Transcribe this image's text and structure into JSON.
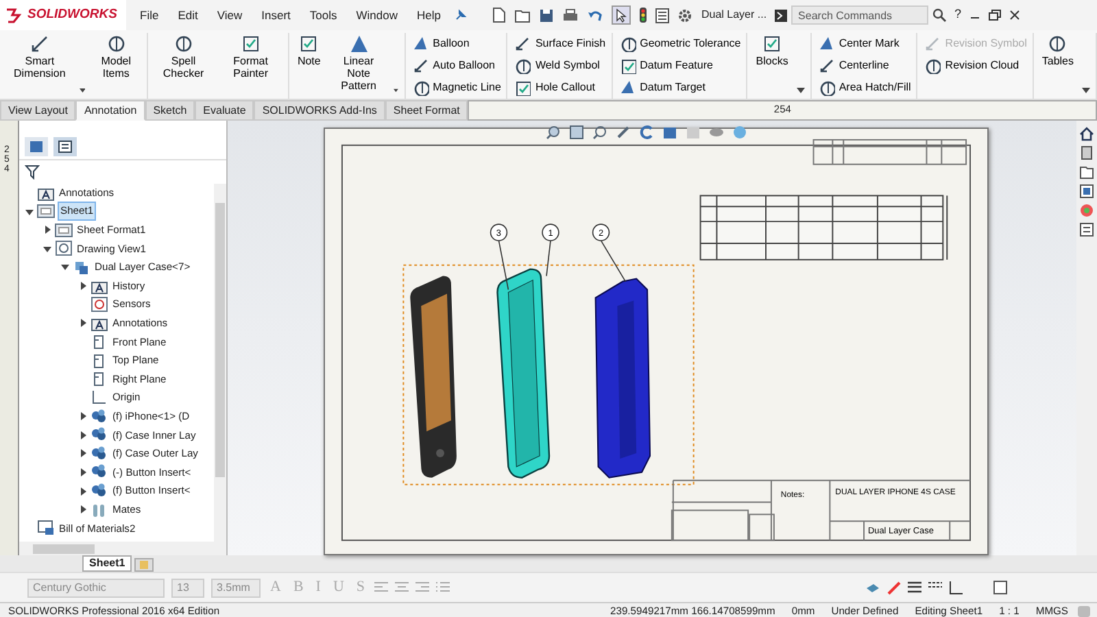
{
  "app": {
    "logo": "SOLIDWORKS",
    "menu": [
      "File",
      "Edit",
      "View",
      "Insert",
      "Tools",
      "Window",
      "Help"
    ],
    "document_title": "Dual Layer ...",
    "search": {
      "placeholder": "Search Commands"
    },
    "help": "?"
  },
  "ribbon": {
    "groups": [
      {
        "items": [
          {
            "label": "Smart Dimension",
            "kind": "large",
            "disabled": false,
            "dropdown": true
          },
          {
            "label": "Model Items",
            "kind": "large",
            "disabled": false,
            "dropdown": false
          }
        ]
      },
      {
        "items": [
          {
            "label": "Spell Checker",
            "kind": "large",
            "disabled": false,
            "dropdown": false
          },
          {
            "label": "Format Painter",
            "kind": "large",
            "disabled": false,
            "dropdown": false
          }
        ]
      },
      {
        "items": [
          {
            "label": "Note",
            "kind": "large",
            "disabled": false,
            "dropdown": false
          },
          {
            "label": "Linear Note Pattern",
            "kind": "large",
            "disabled": false,
            "dropdown": true
          }
        ]
      },
      {
        "items": [
          {
            "label": "Balloon",
            "kind": "small",
            "disabled": false
          },
          {
            "label": "Auto Balloon",
            "kind": "small",
            "disabled": false
          },
          {
            "label": "Magnetic Line",
            "kind": "small",
            "disabled": false
          }
        ]
      },
      {
        "items": [
          {
            "label": "Surface Finish",
            "kind": "small",
            "disabled": false
          },
          {
            "label": "Weld Symbol",
            "kind": "small",
            "disabled": false
          },
          {
            "label": "Hole Callout",
            "kind": "small",
            "disabled": false
          }
        ]
      },
      {
        "items": [
          {
            "label": "Geometric Tolerance",
            "kind": "small",
            "disabled": false
          },
          {
            "label": "Datum Feature",
            "kind": "small",
            "disabled": false
          },
          {
            "label": "Datum Target",
            "kind": "small",
            "disabled": false
          }
        ]
      },
      {
        "items": [
          {
            "label": "Blocks",
            "kind": "large",
            "disabled": false,
            "dropdown": true
          }
        ]
      },
      {
        "items": [
          {
            "label": "Center Mark",
            "kind": "small",
            "disabled": false
          },
          {
            "label": "Centerline",
            "kind": "small",
            "disabled": false
          },
          {
            "label": "Area Hatch/Fill",
            "kind": "small",
            "disabled": false
          }
        ]
      },
      {
        "items": [
          {
            "label": "Revision Symbol",
            "kind": "small",
            "disabled": true
          },
          {
            "label": "Revision Cloud",
            "kind": "small",
            "disabled": false
          }
        ]
      },
      {
        "items": [
          {
            "label": "Tables",
            "kind": "large",
            "disabled": false,
            "dropdown": true
          }
        ]
      }
    ]
  },
  "tabs": [
    {
      "label": "View Layout",
      "selected": false
    },
    {
      "label": "Annotation",
      "selected": true
    },
    {
      "label": "Sketch",
      "selected": false
    },
    {
      "label": "Evaluate",
      "selected": false
    },
    {
      "label": "SOLIDWORKS Add-Ins",
      "selected": false
    },
    {
      "label": "Sheet Format",
      "selected": false
    }
  ],
  "top_ruler": {
    "label": "254"
  },
  "side_ruler": {
    "label": "254"
  },
  "tree": [
    {
      "label": "Annotations",
      "kind": "folder",
      "expandable": false,
      "selected": false
    },
    {
      "label": "Sheet1",
      "kind": "sheet",
      "expandable": true,
      "expanded": true,
      "selected": true,
      "children": [
        {
          "label": "Sheet Format1",
          "kind": "sheet",
          "expandable": true,
          "expanded": false,
          "selected": false
        },
        {
          "label": "Drawing View1",
          "kind": "view",
          "expandable": true,
          "expanded": true,
          "selected": false,
          "children": [
            {
              "label": "Dual Layer Case<7>",
              "kind": "assembly",
              "expandable": true,
              "expanded": true,
              "selected": false,
              "children": [
                {
                  "label": "History",
                  "kind": "folder",
                  "expandable": true,
                  "expanded": false,
                  "selected": false
                },
                {
                  "label": "Sensors",
                  "kind": "sensor",
                  "expandable": false,
                  "selected": false
                },
                {
                  "label": "Annotations",
                  "kind": "folder",
                  "expandable": true,
                  "expanded": false,
                  "selected": false
                },
                {
                  "label": "Front Plane",
                  "kind": "plane",
                  "expandable": false,
                  "selected": false
                },
                {
                  "label": "Top Plane",
                  "kind": "plane",
                  "expandable": false,
                  "selected": false
                },
                {
                  "label": "Right Plane",
                  "kind": "plane",
                  "expandable": false,
                  "selected": false
                },
                {
                  "label": "Origin",
                  "kind": "origin",
                  "expandable": false,
                  "selected": false
                },
                {
                  "label": "(f) iPhone<1> (D",
                  "kind": "part",
                  "expandable": true,
                  "expanded": false,
                  "selected": false
                },
                {
                  "label": "(f) Case Inner Lay",
                  "kind": "part",
                  "expandable": true,
                  "expanded": false,
                  "selected": false
                },
                {
                  "label": "(f) Case Outer Lay",
                  "kind": "part",
                  "expandable": true,
                  "expanded": false,
                  "selected": false
                },
                {
                  "label": "(-) Button Insert<",
                  "kind": "part",
                  "expandable": true,
                  "expanded": false,
                  "selected": false
                },
                {
                  "label": "(f) Button Insert<",
                  "kind": "part",
                  "expandable": true,
                  "expanded": false,
                  "selected": false
                },
                {
                  "label": "Mates",
                  "kind": "mates",
                  "expandable": true,
                  "expanded": false,
                  "selected": false
                }
              ]
            }
          ]
        }
      ]
    },
    {
      "label": "Bill of Materials2",
      "kind": "bom",
      "expandable": false,
      "selected": false
    }
  ],
  "sheet": {
    "balloons": [
      "3",
      "1",
      "2"
    ],
    "notes_label": "Notes:",
    "title": "DUAL LAYER IPHONE 4S CASE",
    "part_name": "Dual Layer Case"
  },
  "sheet_tabs": [
    {
      "label": "Sheet1",
      "selected": true
    }
  ],
  "format_toolbar": {
    "font": "Century Gothic",
    "size": "13",
    "height": "3.5mm",
    "style_buttons": [
      "A",
      "B",
      "I",
      "U",
      "S"
    ]
  },
  "status_bar": [
    "SOLIDWORKS Professional 2016 x64 Edition",
    "239.5949217mm 166.14708599mm",
    "0mm",
    "Under Defined",
    "Editing Sheet1",
    "1 : 1",
    "MMGS"
  ]
}
